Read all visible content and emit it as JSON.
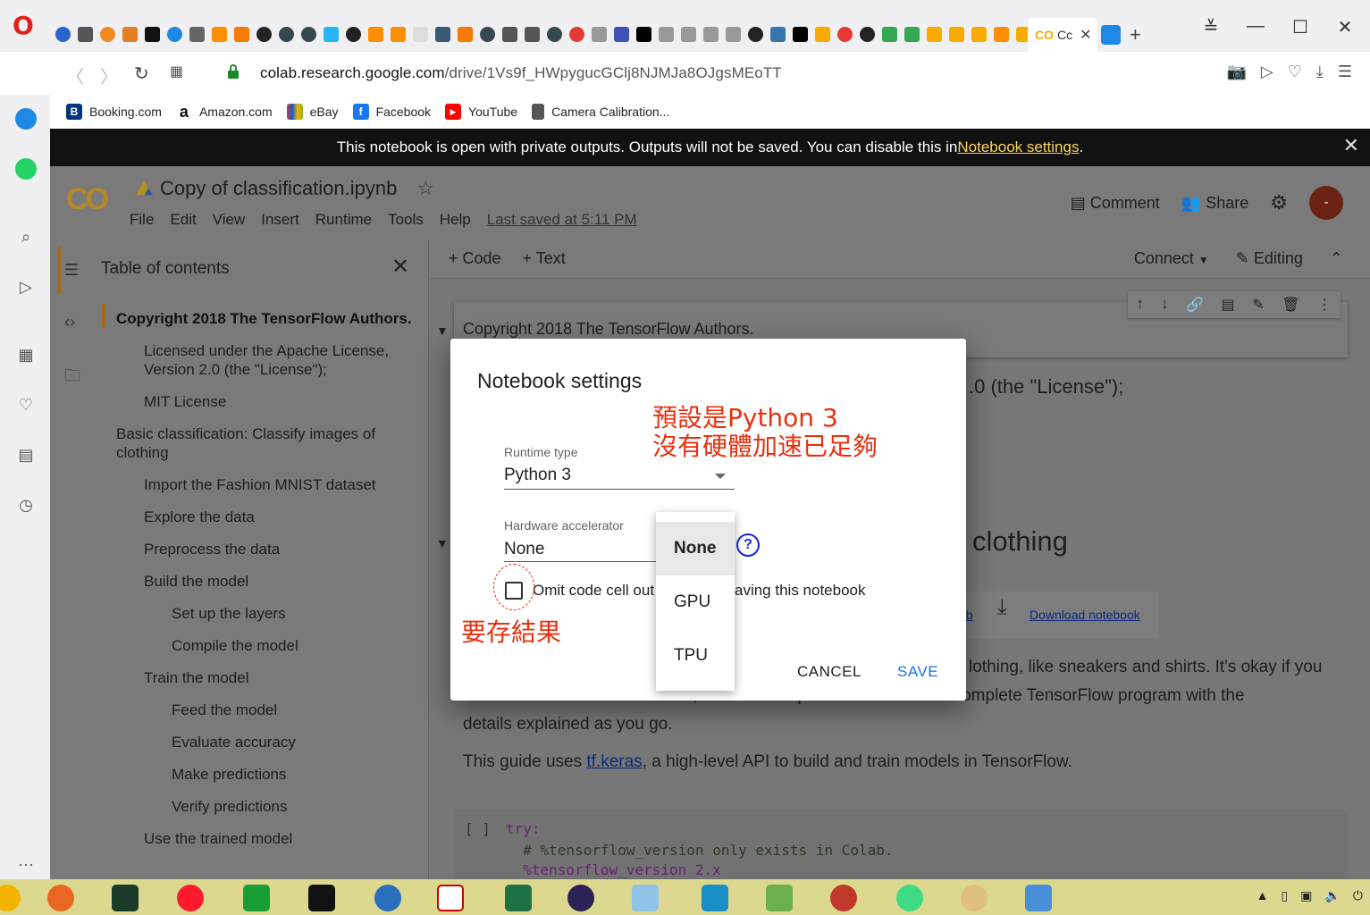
{
  "browser": {
    "active_tab_label": "Cc",
    "url_host": "colab.research.google.com",
    "url_path": "/drive/1Vs9f_HWpygucGClj8NJMJa8OJgsMEoTT"
  },
  "bookmarks": [
    {
      "label": "Booking.com",
      "icon": "B",
      "color": "#003580"
    },
    {
      "label": "Amazon.com",
      "icon": "a",
      "color": "#111111"
    },
    {
      "label": "eBay",
      "icon": "",
      "color": "#e53238"
    },
    {
      "label": "Facebook",
      "icon": "f",
      "color": "#1877f2"
    },
    {
      "label": "YouTube",
      "icon": "▶",
      "color": "#ff0000"
    },
    {
      "label": "Camera Calibration...",
      "icon": "",
      "color": "#555555"
    }
  ],
  "privbar": {
    "text": "This notebook is open with private outputs. Outputs will not be saved. You can disable this in ",
    "link": "Notebook settings",
    "suffix": "."
  },
  "colab": {
    "title": "Copy of classification.ipynb",
    "menus": [
      "File",
      "Edit",
      "View",
      "Insert",
      "Runtime",
      "Tools",
      "Help"
    ],
    "last_saved": "Last saved at 5:11 PM",
    "comment": "Comment",
    "share": "Share",
    "avatar": "-",
    "add_code": "+ Code",
    "add_text": "+ Text",
    "connect": "Connect",
    "editing": "Editing"
  },
  "toc": {
    "title": "Table of contents",
    "items": [
      "Copyright 2018 The TensorFlow Authors.",
      "Licensed under the Apache License,",
      "Version 2.0 (the \"License\");",
      "MIT License",
      "Basic classification: Classify images of",
      "clothing",
      "Import the Fashion MNIST dataset",
      "Explore the data",
      "Preprocess the data",
      "Build the model",
      "Set up the layers",
      "Compile the model",
      "Train the model",
      "Feed the model",
      "Evaluate accuracy",
      "Make predictions",
      "Verify predictions",
      "Use the trained model"
    ]
  },
  "content": {
    "copyright": "Copyright 2018 The TensorFlow Authors.",
    "license_frag": ".0 (the \"License\");",
    "heading_frag": "clothing",
    "github_frag": "itHub",
    "download": "Download notebook",
    "para1_frag": "lothing, like sneakers and shirts. It's okay if you",
    "para1_line2": "don't understand all the details; this is a fast-paced overview of a complete TensorFlow program with the",
    "para1_line3": "details explained as you go.",
    "para2_pre": "This guide uses ",
    "para2_link": "tf.keras",
    "para2_post": ", a high-level API to build and train models in TensorFlow.",
    "code_bracket": "[ ]",
    "code_line1": "try:",
    "code_line2": "  # %tensorflow_version only exists in Colab.",
    "code_line3": "  %tensorflow_version 2.x"
  },
  "dialog": {
    "title": "Notebook settings",
    "runtime_label": "Runtime type",
    "runtime_value": "Python 3",
    "hw_label": "Hardware accelerator",
    "hw_value": "None",
    "omit_text": "Omit code cell out",
    "omit_text2": "aving this notebook",
    "cancel": "CANCEL",
    "save": "SAVE",
    "options": [
      "None",
      "GPU",
      "TPU"
    ]
  },
  "annotations": {
    "line1": "預設是Python 3",
    "line2": "沒有硬體加速已足夠",
    "checkbox_note": "要存結果"
  },
  "colors": {
    "accent_blue": "#1a73e8",
    "annotation_red": "#e8300e",
    "colab_orange": "#f9ab00"
  }
}
